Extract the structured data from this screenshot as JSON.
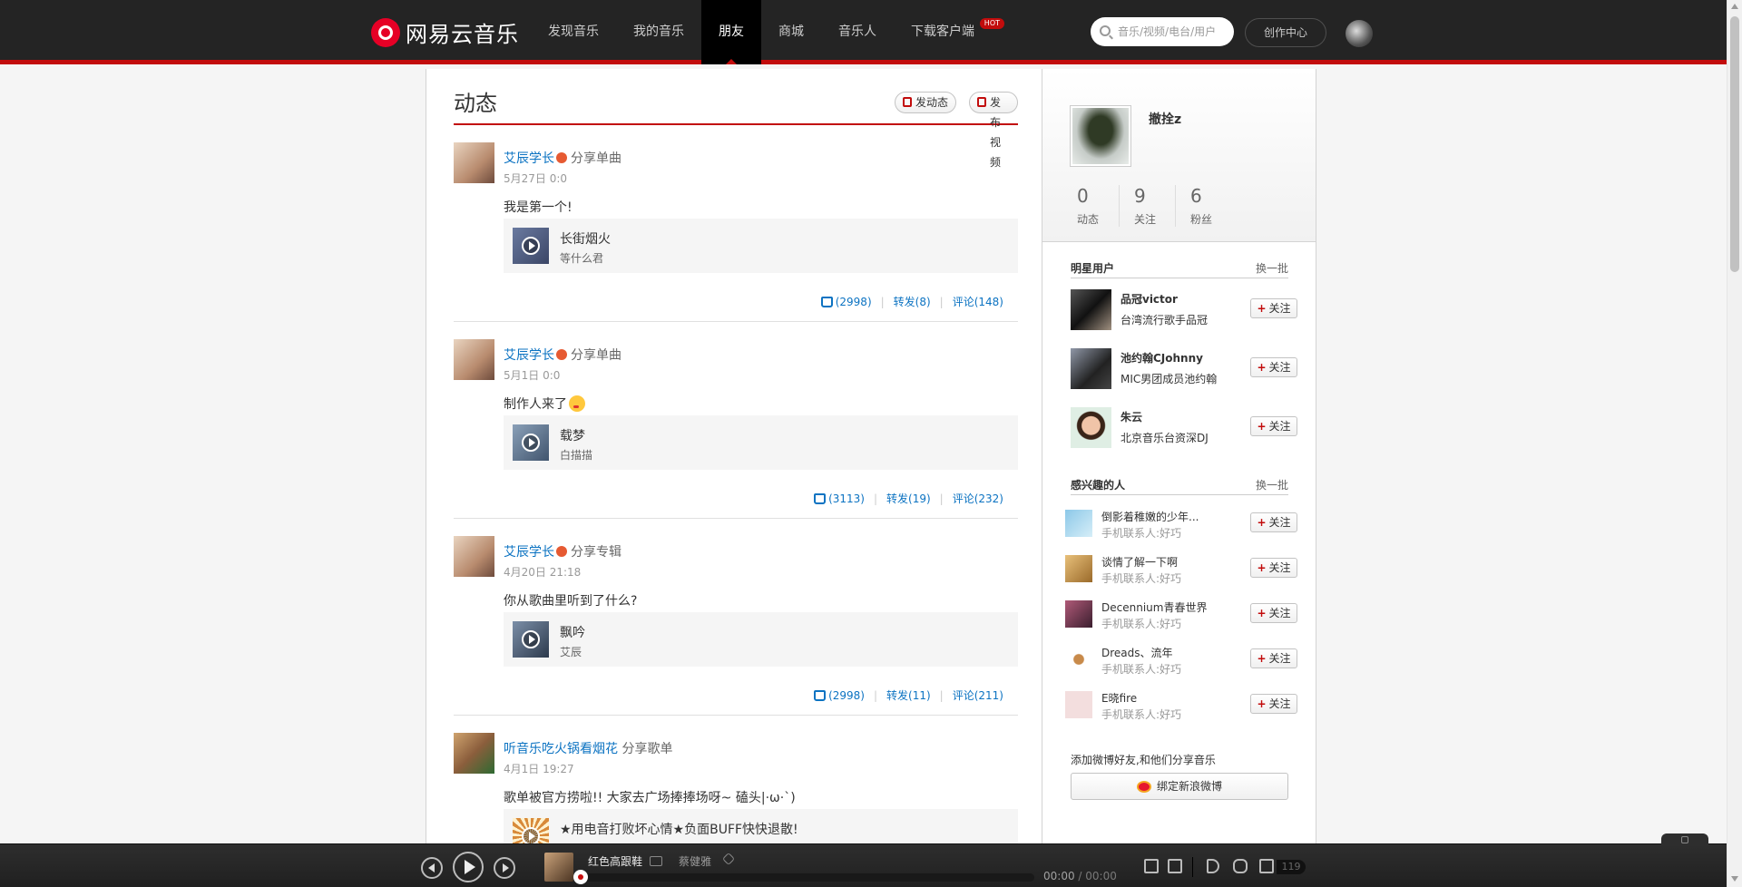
{
  "header": {
    "logo_text": "网易云音乐",
    "nav": [
      {
        "label": "发现音乐"
      },
      {
        "label": "我的音乐"
      },
      {
        "label": "朋友"
      },
      {
        "label": "商城"
      },
      {
        "label": "音乐人"
      },
      {
        "label": "下载客户端"
      }
    ],
    "active_nav": "朋友",
    "hot_badge": "HOT",
    "search_placeholder": "音乐/视频/电台/用户",
    "creator_center": "创作中心"
  },
  "feed": {
    "title": "动态",
    "post_button": "发动态",
    "video_button": "发布视频",
    "posts": [
      {
        "author": "艾辰学长",
        "action": "分享单曲",
        "time": "5月27日 0:0",
        "text": "我是第一个!",
        "song": "长街烟火",
        "artist": "等什么君",
        "likes": "(2998)",
        "forwards": "转发(8)",
        "comments": "评论(148)"
      },
      {
        "author": "艾辰学长",
        "action": "分享单曲",
        "time": "5月1日 0:0",
        "text": "制作人来了",
        "song": "载梦",
        "artist": "白描描",
        "likes": "(3113)",
        "forwards": "转发(19)",
        "comments": "评论(232)"
      },
      {
        "author": "艾辰学长",
        "action": "分享专辑",
        "time": "4月20日 21:18",
        "text": "你从歌曲里听到了什么?",
        "song": "飘吟",
        "artist": "艾辰",
        "likes": "(2998)",
        "forwards": "转发(11)",
        "comments": "评论(211)"
      },
      {
        "author": "听音乐吃火锅看烟花",
        "action": "分享歌单",
        "time": "4月1日 19:27",
        "text": "歌单被官方捞啦!! 大家去广场捧捧场呀~ 磕头|·ω·`)",
        "song": "★用电音打败坏心情★负面BUFF快快退散!"
      }
    ]
  },
  "profile": {
    "name": "撤拴z",
    "stats": [
      {
        "num": "0",
        "label": "动态"
      },
      {
        "num": "9",
        "label": "关注"
      },
      {
        "num": "6",
        "label": "粉丝"
      }
    ]
  },
  "star_users": {
    "title": "明星用户",
    "more": "换一批",
    "users": [
      {
        "name": "品冠victor",
        "desc": "台湾流行歌手品冠"
      },
      {
        "name": "池约翰CJohnny",
        "desc": "MIC男团成员池约翰"
      },
      {
        "name": "朱云",
        "desc": "北京音乐台资深DJ"
      }
    ]
  },
  "interest_users": {
    "title": "感兴趣的人",
    "more": "换一批",
    "users": [
      {
        "name": "倒影着稚嫩的少年...",
        "desc": "手机联系人:好巧"
      },
      {
        "name": "谈情了解一下啊",
        "desc": "手机联系人:好巧"
      },
      {
        "name": "Decennium青春世界",
        "desc": "手机联系人:好巧"
      },
      {
        "name": "Dreads、流年",
        "desc": "手机联系人:好巧"
      },
      {
        "name": "E晓fire",
        "desc": "手机联系人:好巧"
      }
    ]
  },
  "follow_label": "关注",
  "weibo": {
    "tip": "添加微博好友,和他们分享音乐",
    "button": "绑定新浪微博"
  },
  "player": {
    "title": "红色高跟鞋",
    "artist": "蔡健雅",
    "current_time": "00:00",
    "total_time": "/ 00:00",
    "progress": 0,
    "playlist_count": "119"
  },
  "colors": {
    "accent": "#c20c0c",
    "link": "#0c73c2",
    "topbar": "#242424"
  }
}
